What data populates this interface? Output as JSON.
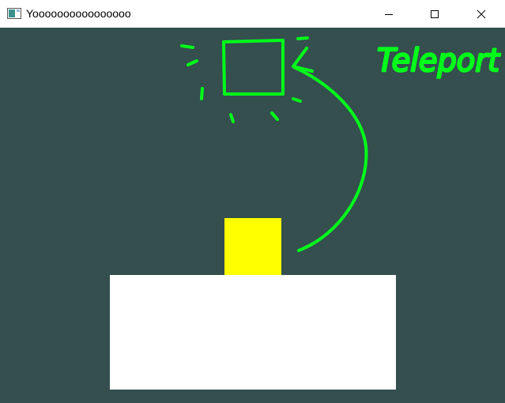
{
  "window": {
    "title": "Yoooooooooooooooo",
    "controls": {
      "minimize_icon": "minimize-icon",
      "maximize_icon": "maximize-icon",
      "close_icon": "close-icon"
    }
  },
  "scene": {
    "background_color": "#344f4e",
    "player_color": "#ffff00",
    "platform_color": "#ffffff",
    "annotation_color": "#00ff1a",
    "annotation_text": "Teleport"
  }
}
